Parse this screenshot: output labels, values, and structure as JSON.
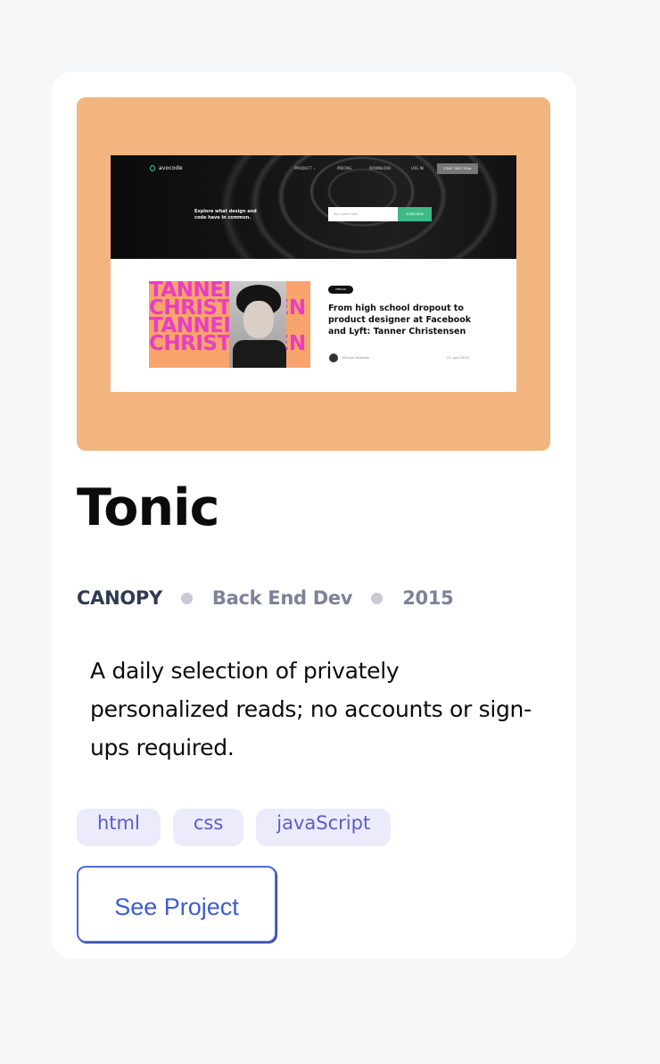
{
  "project": {
    "title": "Tonic",
    "client": "CANOPY",
    "role": "Back End Dev",
    "year": "2015",
    "description": "A daily selection of privately personalized reads; no accounts or sign-ups required.",
    "tags": [
      "html",
      "css",
      "javaScript"
    ],
    "cta_label": "See Project"
  },
  "preview": {
    "logo": "avocode",
    "nav": [
      "PRODUCT ⌄",
      "PRICING",
      "DOWNLOAD"
    ],
    "login": "LOG IN",
    "button": "START FREE TRIAL",
    "hero_text": "Explore what design and code have in common.",
    "email_placeholder": "Your email here",
    "subscribe": "SUBSCRIBE",
    "badge": "DESIGN",
    "image_text": [
      "TANNER",
      "CHRISTENSEN",
      "TANNER",
      "CHRISTENSEN"
    ],
    "article_title": "From high school dropout to product designer at Facebook and Lyft: Tanner Christensen",
    "author": "Michael Mathews",
    "date": "25. April 2019"
  },
  "colors": {
    "preview_bg": "#f3b580",
    "accent": "#4f69d6",
    "tag_bg": "#ebebfb",
    "tag_text": "#5a5ecb"
  }
}
